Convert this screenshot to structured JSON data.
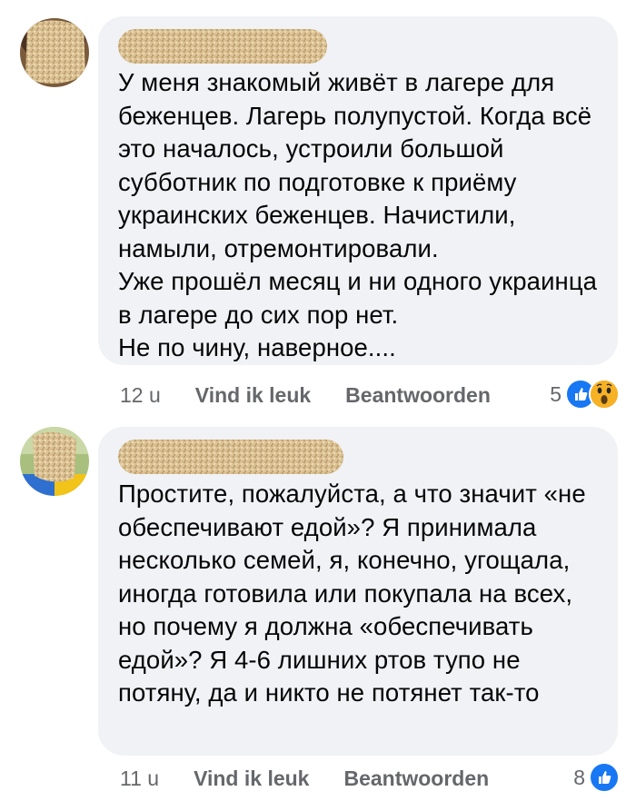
{
  "comments": [
    {
      "text": "У меня знакомый живёт в лагере для беженцев. Лагерь полупустой. Когда всё это началось, устроили большой субботник по подготовке к приёму украинских беженцев. Начистили, намыли, отремонтировали.\nУже прошёл месяц и ни одного украинца в лагере до сих пор нет.\nНе по чину, наверное....",
      "time": "12 u",
      "like_label": "Vind ik leuk",
      "reply_label": "Beantwoorden",
      "reaction_count": "5",
      "reaction_icons": [
        "like-icon",
        "wow-icon"
      ]
    },
    {
      "text": "Простите, пожалуйста, а что значит «не обеспечивают едой»? Я принимала несколько семей, я, конечно, угощала, иногда готовила или покупала на всех, но почему я должна «обеспечивать едой»? Я 4-6 лишних ртов тупо не потяну, да и никто не потянет так-то",
      "time": "11 u",
      "like_label": "Vind ik leuk",
      "reply_label": "Beantwoorden",
      "reaction_count": "8",
      "reaction_icons": [
        "like-icon"
      ]
    }
  ],
  "colors": {
    "bubble": "#f0f2f5",
    "meta_text": "#65676b",
    "like_blue": "#1877f2",
    "wow_yellow": "#f7b125",
    "redaction": "#d9bf8f"
  }
}
